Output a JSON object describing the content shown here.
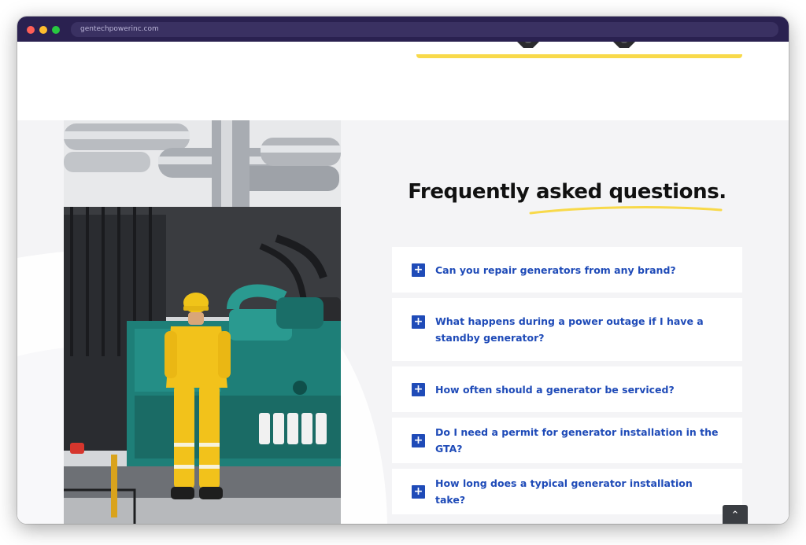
{
  "browser": {
    "url": "gentechpowerinc.com"
  },
  "faq": {
    "heading": "Frequently asked questions.",
    "items": [
      {
        "question": "Can you repair generators from any brand?"
      },
      {
        "question": "What happens during a power outage if I have a standby generator?"
      },
      {
        "question": "How often should a generator be serviced?"
      },
      {
        "question": "Do I need a permit for generator installation in the GTA?"
      },
      {
        "question": "How long does a typical generator installation take?"
      }
    ],
    "toggle_icon": "+"
  },
  "scroll_top": {
    "icon": "chevron-up-icon",
    "glyph": "⌃"
  },
  "colors": {
    "accent_blue": "#1f4bb8",
    "highlight_yellow": "#f8d94a",
    "section_bg": "#f4f4f6",
    "titlebar": "#2a2150"
  }
}
